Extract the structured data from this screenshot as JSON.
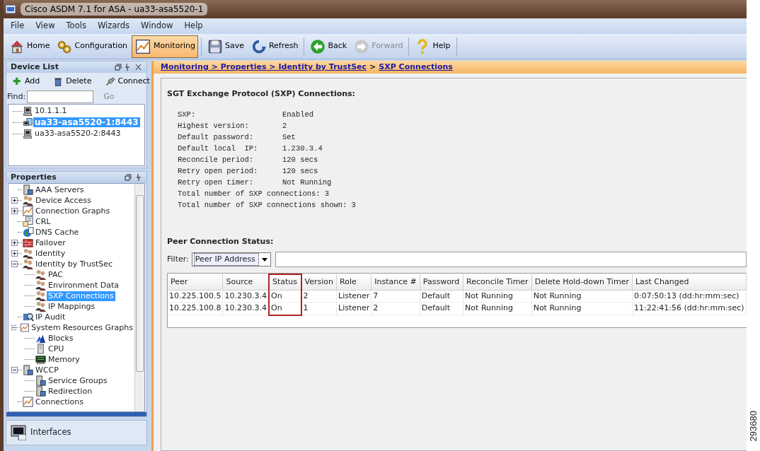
{
  "window": {
    "title": "Cisco ASDM 7.1 for ASA - ua33-asa5520-1"
  },
  "menu": [
    "File",
    "View",
    "Tools",
    "Wizards",
    "Window",
    "Help"
  ],
  "toolbar": [
    {
      "label": "Home",
      "selected": false,
      "disabled": false
    },
    {
      "label": "Configuration",
      "selected": false,
      "disabled": false
    },
    {
      "label": "Monitoring",
      "selected": true,
      "disabled": false
    },
    {
      "label": "Save",
      "selected": false,
      "disabled": false
    },
    {
      "label": "Refresh",
      "selected": false,
      "disabled": false
    },
    {
      "label": "Back",
      "selected": false,
      "disabled": false
    },
    {
      "label": "Forward",
      "selected": false,
      "disabled": true
    },
    {
      "label": "Help",
      "selected": false,
      "disabled": false
    }
  ],
  "device_list": {
    "title": "Device List",
    "actions": [
      "Add",
      "Delete",
      "Connect"
    ],
    "find_label": "Find:",
    "go_button": {
      "label": "Go",
      "disabled": true
    },
    "items": [
      {
        "label": "10.1.1.1",
        "selected": false
      },
      {
        "label": "ua33-asa5520-1:8443",
        "selected": true
      },
      {
        "label": "ua33-asa5520-2:8443",
        "selected": false
      }
    ]
  },
  "properties": {
    "title": "Properties",
    "items": [
      {
        "label": "AAA Servers",
        "selected": false
      },
      {
        "label": "Device Access",
        "selected": false,
        "expanded": false
      },
      {
        "label": "Connection Graphs",
        "selected": false,
        "expanded": false
      },
      {
        "label": "CRL",
        "selected": false
      },
      {
        "label": "DNS Cache",
        "selected": false
      },
      {
        "label": "Failover",
        "selected": false,
        "expanded": false
      },
      {
        "label": "Identity",
        "selected": false,
        "expanded": false
      },
      {
        "label": "Identity by TrustSec",
        "selected": false,
        "expanded": true,
        "children": [
          {
            "label": "PAC",
            "selected": false
          },
          {
            "label": "Environment Data",
            "selected": false
          },
          {
            "label": "SXP Connections",
            "selected": true
          },
          {
            "label": "IP Mappings",
            "selected": false
          }
        ]
      },
      {
        "label": "IP Audit",
        "selected": false
      },
      {
        "label": "System Resources Graphs",
        "selected": false,
        "expanded": true,
        "children": [
          {
            "label": "Blocks",
            "selected": false
          },
          {
            "label": "CPU",
            "selected": false
          },
          {
            "label": "Memory",
            "selected": false
          }
        ]
      },
      {
        "label": "WCCP",
        "selected": false,
        "expanded": true,
        "children": [
          {
            "label": "Service Groups",
            "selected": false
          },
          {
            "label": "Redirection",
            "selected": false
          }
        ]
      },
      {
        "label": "Connections",
        "selected": false
      }
    ]
  },
  "interfaces_button": {
    "label": "Interfaces"
  },
  "breadcrumb": {
    "links": [
      "Monitoring > Properties > Identity by TrustSec",
      "SXP Connections"
    ],
    "separator": ">"
  },
  "sxp": {
    "heading": "SGT Exchange Protocol (SXP) Connections:",
    "lines": [
      {
        "kind": "aligned",
        "label": "SXP:",
        "value": "Enabled"
      },
      {
        "kind": "aligned",
        "label": "Highest version:",
        "value": "2"
      },
      {
        "kind": "aligned",
        "label": "Default password:",
        "value": "Set"
      },
      {
        "kind": "aligned",
        "label": "Default local  IP:",
        "value": "1.230.3.4"
      },
      {
        "kind": "aligned",
        "label": "Reconcile period:",
        "value": "120 secs"
      },
      {
        "kind": "aligned",
        "label": "Retry open period:",
        "value": "120 secs"
      },
      {
        "kind": "aligned",
        "label": "Retry open timer:",
        "value": "Not Running"
      },
      {
        "kind": "inline",
        "label": "Total number of SXP connections:",
        "value": "3"
      },
      {
        "kind": "inline",
        "label": "Total number of SXP connections shown:",
        "value": "3"
      }
    ]
  },
  "peer_status": {
    "heading": "Peer Connection Status:",
    "filter_label": "Filter:",
    "filter_value": "Peer IP Address",
    "table": {
      "columns": [
        {
          "label": "Peer",
          "highlighted": false
        },
        {
          "label": "Source",
          "highlighted": false
        },
        {
          "label": "Status",
          "highlighted": true
        },
        {
          "label": "Version",
          "highlighted": false
        },
        {
          "label": "Role",
          "highlighted": false
        },
        {
          "label": "Instance #",
          "highlighted": false
        },
        {
          "label": "Password",
          "highlighted": false
        },
        {
          "label": "Reconcile Timer",
          "highlighted": false
        },
        {
          "label": "Delete Hold-down Timer",
          "highlighted": false
        },
        {
          "label": "Last Changed",
          "highlighted": false
        }
      ],
      "rows": [
        [
          "10.225.100.5",
          "10.230.3.4",
          "On",
          "2",
          "Listener",
          "7",
          "Default",
          "Not Running",
          "Not Running",
          "0:07:50:13 (dd:hr:mm:sec)"
        ],
        [
          "10.225.100.8",
          "10.230.3.4",
          "On",
          "1",
          "Listener",
          "2",
          "Default",
          "Not Running",
          "Not Running",
          "11:22:41:56 (dd:hr:mm:sec)"
        ]
      ]
    }
  },
  "figure_number": "293680"
}
